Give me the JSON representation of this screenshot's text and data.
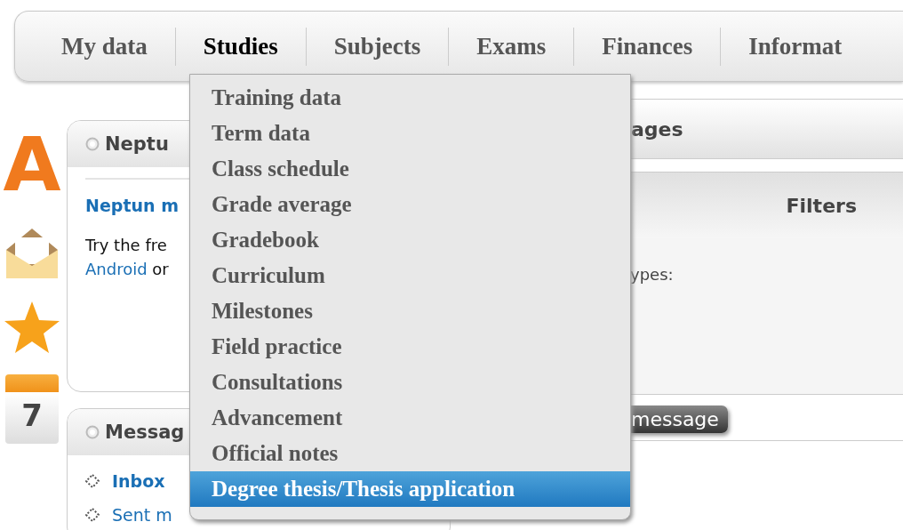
{
  "nav": {
    "tabs": [
      {
        "label": "My data",
        "selected": false
      },
      {
        "label": "Studies",
        "selected": true
      },
      {
        "label": "Subjects",
        "selected": false
      },
      {
        "label": "Exams",
        "selected": false
      },
      {
        "label": "Finances",
        "selected": false
      },
      {
        "label": "Informat",
        "selected": false
      }
    ]
  },
  "dropdown": {
    "items": [
      {
        "label": "Training data",
        "selected": false
      },
      {
        "label": "Term data",
        "selected": false
      },
      {
        "label": "Class schedule",
        "selected": false
      },
      {
        "label": "Grade average",
        "selected": false
      },
      {
        "label": "Gradebook",
        "selected": false
      },
      {
        "label": "Curriculum",
        "selected": false
      },
      {
        "label": "Milestones",
        "selected": false
      },
      {
        "label": "Field practice",
        "selected": false
      },
      {
        "label": "Consultations",
        "selected": false
      },
      {
        "label": "Advancement",
        "selected": false
      },
      {
        "label": "Official notes",
        "selected": false
      },
      {
        "label": "Degree thesis/Thesis application",
        "selected": true
      }
    ]
  },
  "sidebar": {
    "icons": [
      {
        "kind": "letter",
        "text": "A"
      },
      {
        "kind": "envelope"
      },
      {
        "kind": "star"
      },
      {
        "kind": "calendar",
        "text": "7"
      }
    ]
  },
  "neptun_panel": {
    "title": "Neptu",
    "heading": "Neptun m",
    "text": "Try the fre",
    "link": "Android",
    "tail": "or"
  },
  "messages_panel": {
    "title": "Messag",
    "links": [
      {
        "label": "Inbox",
        "bold": true
      },
      {
        "label": "Sent m",
        "bold": false
      }
    ]
  },
  "messages_main": {
    "title": "ages",
    "filters_title": "Filters",
    "filter_label": "ypes:",
    "button": "message"
  }
}
